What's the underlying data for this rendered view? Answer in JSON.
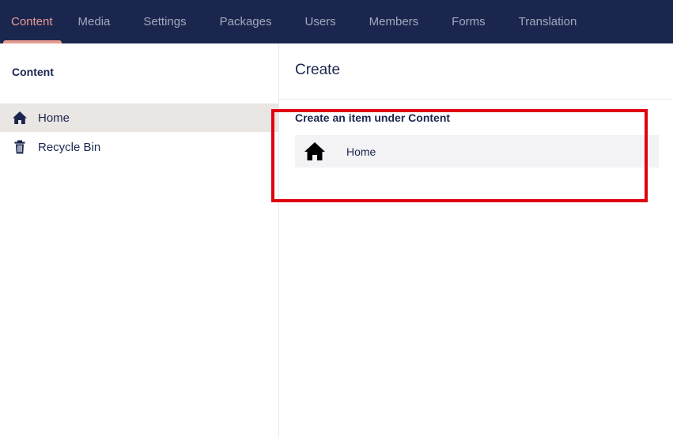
{
  "nav": {
    "items": [
      {
        "label": "Content",
        "active": true
      },
      {
        "label": "Media",
        "active": false
      },
      {
        "label": "Settings",
        "active": false
      },
      {
        "label": "Packages",
        "active": false
      },
      {
        "label": "Users",
        "active": false
      },
      {
        "label": "Members",
        "active": false
      },
      {
        "label": "Forms",
        "active": false
      },
      {
        "label": "Translation",
        "active": false
      }
    ]
  },
  "tree": {
    "title": "Content",
    "items": [
      {
        "label": "Home",
        "icon": "home-icon",
        "selected": true
      },
      {
        "label": "Recycle Bin",
        "icon": "trash-icon",
        "selected": false
      }
    ]
  },
  "editor": {
    "title": "Create",
    "subtitle": "Create an item under Content",
    "options": [
      {
        "label": "Home",
        "icon": "home-icon"
      }
    ]
  },
  "colors": {
    "nav_bg": "#1b264f",
    "nav_active": "#e59c8f",
    "nav_text": "#a4a8bd",
    "highlight": "#e0000f"
  }
}
